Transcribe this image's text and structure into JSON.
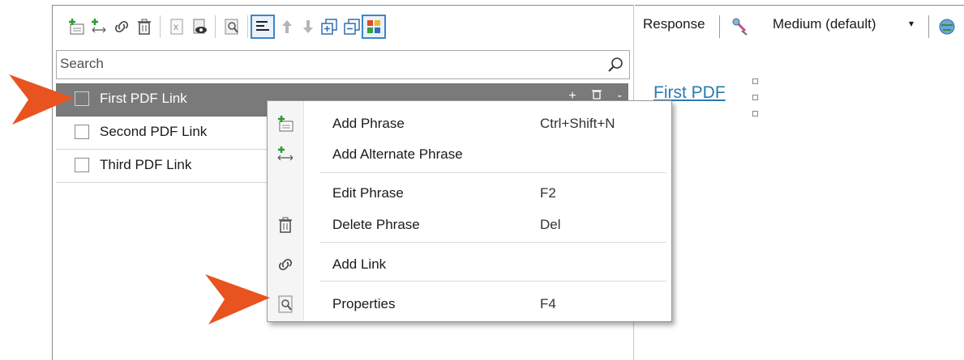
{
  "search": {
    "placeholder": "Search"
  },
  "phrases": [
    {
      "label": "First PDF Link",
      "selected": true
    },
    {
      "label": "Second PDF Link",
      "selected": false
    },
    {
      "label": "Third PDF Link",
      "selected": false
    }
  ],
  "row_actions": {
    "add": "+",
    "menu": "-"
  },
  "right_pane": {
    "response_label": "Response",
    "voice_label": "Medium (default)",
    "dropdown_glyph": "▾",
    "link_text": "First PDF"
  },
  "menu": {
    "items": [
      {
        "label": "Add Phrase",
        "shortcut": "Ctrl+Shift+N",
        "icon": "add-phrase-icon"
      },
      {
        "label": "Add Alternate Phrase",
        "shortcut": "",
        "icon": "add-alternate-phrase-icon"
      },
      {
        "label": "Edit Phrase",
        "shortcut": "F2",
        "icon": ""
      },
      {
        "label": "Delete Phrase",
        "shortcut": "Del",
        "icon": "trash-icon"
      },
      {
        "label": "Add Link",
        "shortcut": "",
        "icon": "link-icon"
      },
      {
        "label": "Properties",
        "shortcut": "F4",
        "icon": "properties-icon"
      }
    ]
  },
  "colors": {
    "accent_arrow": "#e8531f",
    "selected_row": "#7a7a7a",
    "link": "#2a7ab0"
  }
}
